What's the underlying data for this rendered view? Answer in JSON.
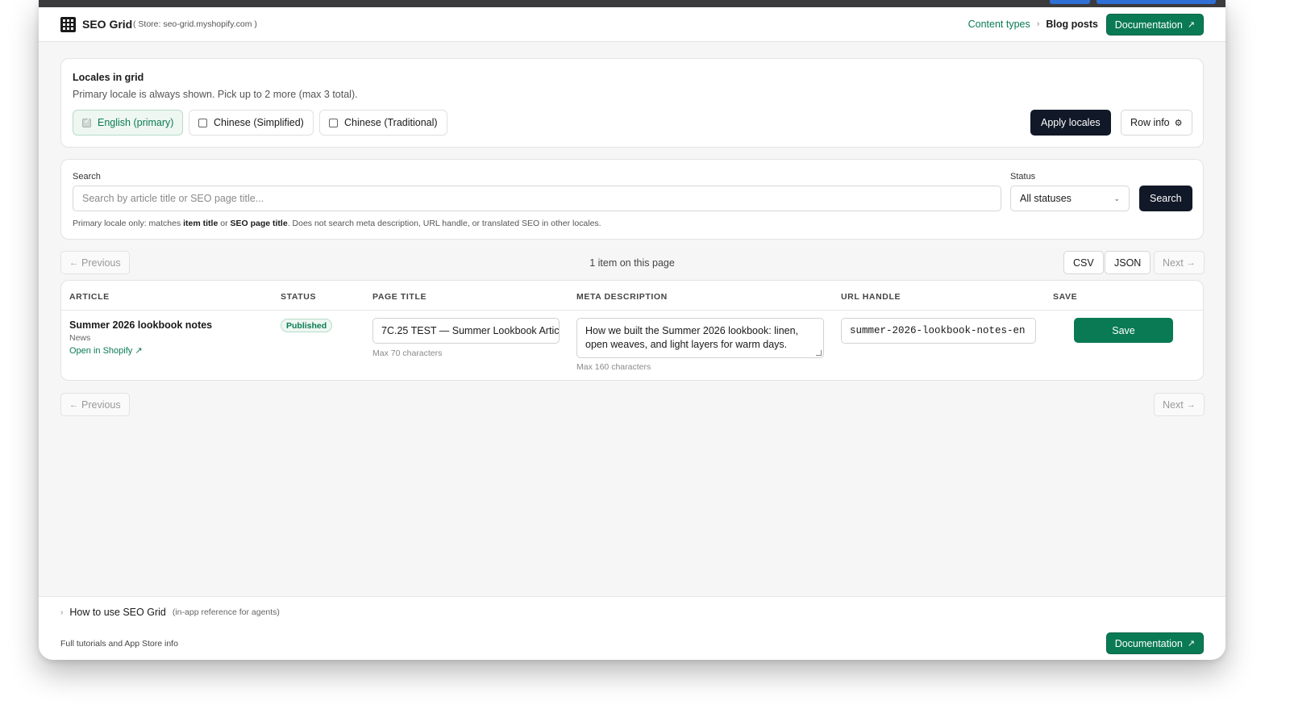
{
  "header": {
    "app_name": "SEO Grid",
    "store_info": "( Store: seo-grid.myshopify.com )",
    "breadcrumbs": [
      "Content types",
      "Blog posts"
    ],
    "documentation_label": "Documentation"
  },
  "locales": {
    "title": "Locales in grid",
    "subtitle": "Primary locale is always shown. Pick up to 2 more (max 3 total).",
    "options": [
      {
        "label": "English (primary)",
        "checked": true
      },
      {
        "label": "Chinese (Simplified)",
        "checked": false
      },
      {
        "label": "Chinese (Traditional)",
        "checked": false
      }
    ],
    "apply_label": "Apply locales",
    "row_info_label": "Row info"
  },
  "search": {
    "label": "Search",
    "placeholder": "Search by article title or SEO page title...",
    "status_label": "Status",
    "status_value": "All statuses",
    "button_label": "Search",
    "hint_parts": [
      "Primary locale only: matches ",
      "item title",
      " or ",
      "SEO page title",
      ". Does not search meta description, URL handle, or translated SEO in other locales."
    ]
  },
  "pagination": {
    "previous_label": "Previous",
    "next_label": "Next",
    "info": "1 item on this page",
    "csv_label": "CSV",
    "json_label": "JSON"
  },
  "table": {
    "columns": [
      "ARTICLE",
      "STATUS",
      "PAGE TITLE",
      "META DESCRIPTION",
      "URL HANDLE",
      "SAVE"
    ],
    "rows": [
      {
        "article_title": "Summer 2026 lookbook notes",
        "blog": "News",
        "open_link": "Open in Shopify",
        "status": "Published",
        "page_title": "7C.25 TEST — Summer Lookbook Artic",
        "page_title_hint": "Max 70 characters",
        "meta_description": "How we built the Summer 2026 lookbook: linen, open weaves, and light layers for warm days.",
        "meta_hint": "Max 160 characters",
        "url_handle": "summer-2026-lookbook-notes-en",
        "save_label": "Save"
      }
    ]
  },
  "footer": {
    "howto_title": "How to use SEO Grid",
    "howto_sub": "(in-app reference for agents)",
    "tutorial_text": "Full tutorials and App Store info",
    "documentation_label": "Documentation"
  },
  "colors": {
    "accent_green": "#0a7a55",
    "dark_button": "#111827",
    "page_background": "#f6f6f7"
  },
  "icons": [
    "grid-logo-icon",
    "chevron-right-icon",
    "external-link-icon",
    "checkbox-icon",
    "gear-icon",
    "chevron-down-icon",
    "arrow-left-icon",
    "arrow-right-icon",
    "resize-grip-icon"
  ]
}
